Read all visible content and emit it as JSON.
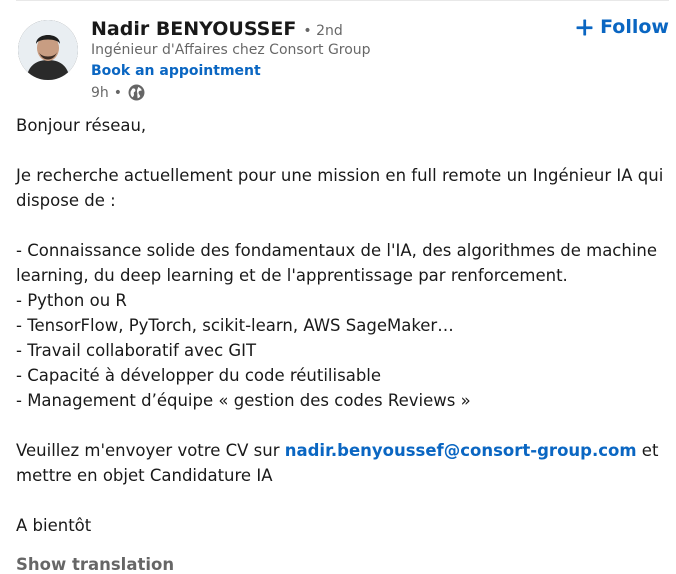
{
  "actor": {
    "name": "Nadir BENYOUSSEF",
    "degree": "• 2nd",
    "headline": "Ingénieur d'Affaires chez Consort Group",
    "book_label": "Book an appointment",
    "time": "9h",
    "time_separator": "•",
    "visibility_icon": "globe-icon",
    "avatar_icon": "avatar-photo"
  },
  "follow": {
    "label": "Follow",
    "icon": "plus-icon"
  },
  "post": {
    "greeting": "Bonjour réseau,",
    "intro": "Je recherche actuellement pour une mission en full remote un Ingénieur IA qui dispose de :",
    "requirements": [
      "- Connaissance solide des fondamentaux de l'IA, des algorithmes de machine learning, du deep learning et de l'apprentissage par renforcement.",
      "- Python ou R",
      "- TensorFlow, PyTorch, scikit-learn, AWS SageMaker…",
      "- Travail collaboratif avec GIT",
      "- Capacité à développer du code réutilisable",
      "- Management d’équipe « gestion des codes Reviews »"
    ],
    "cta_before": "Veuillez m'envoyer votre CV sur ",
    "cta_email": "nadir.benyoussef@consort-group.com",
    "cta_after": " et mettre en objet Candidature IA",
    "closing": "A bientôt"
  },
  "translation": {
    "label": "Show translation"
  },
  "colors": {
    "link_blue": "#0a66c2",
    "text_primary": "rgba(0,0,0,0.9)",
    "text_secondary": "rgba(0,0,0,0.6)"
  }
}
